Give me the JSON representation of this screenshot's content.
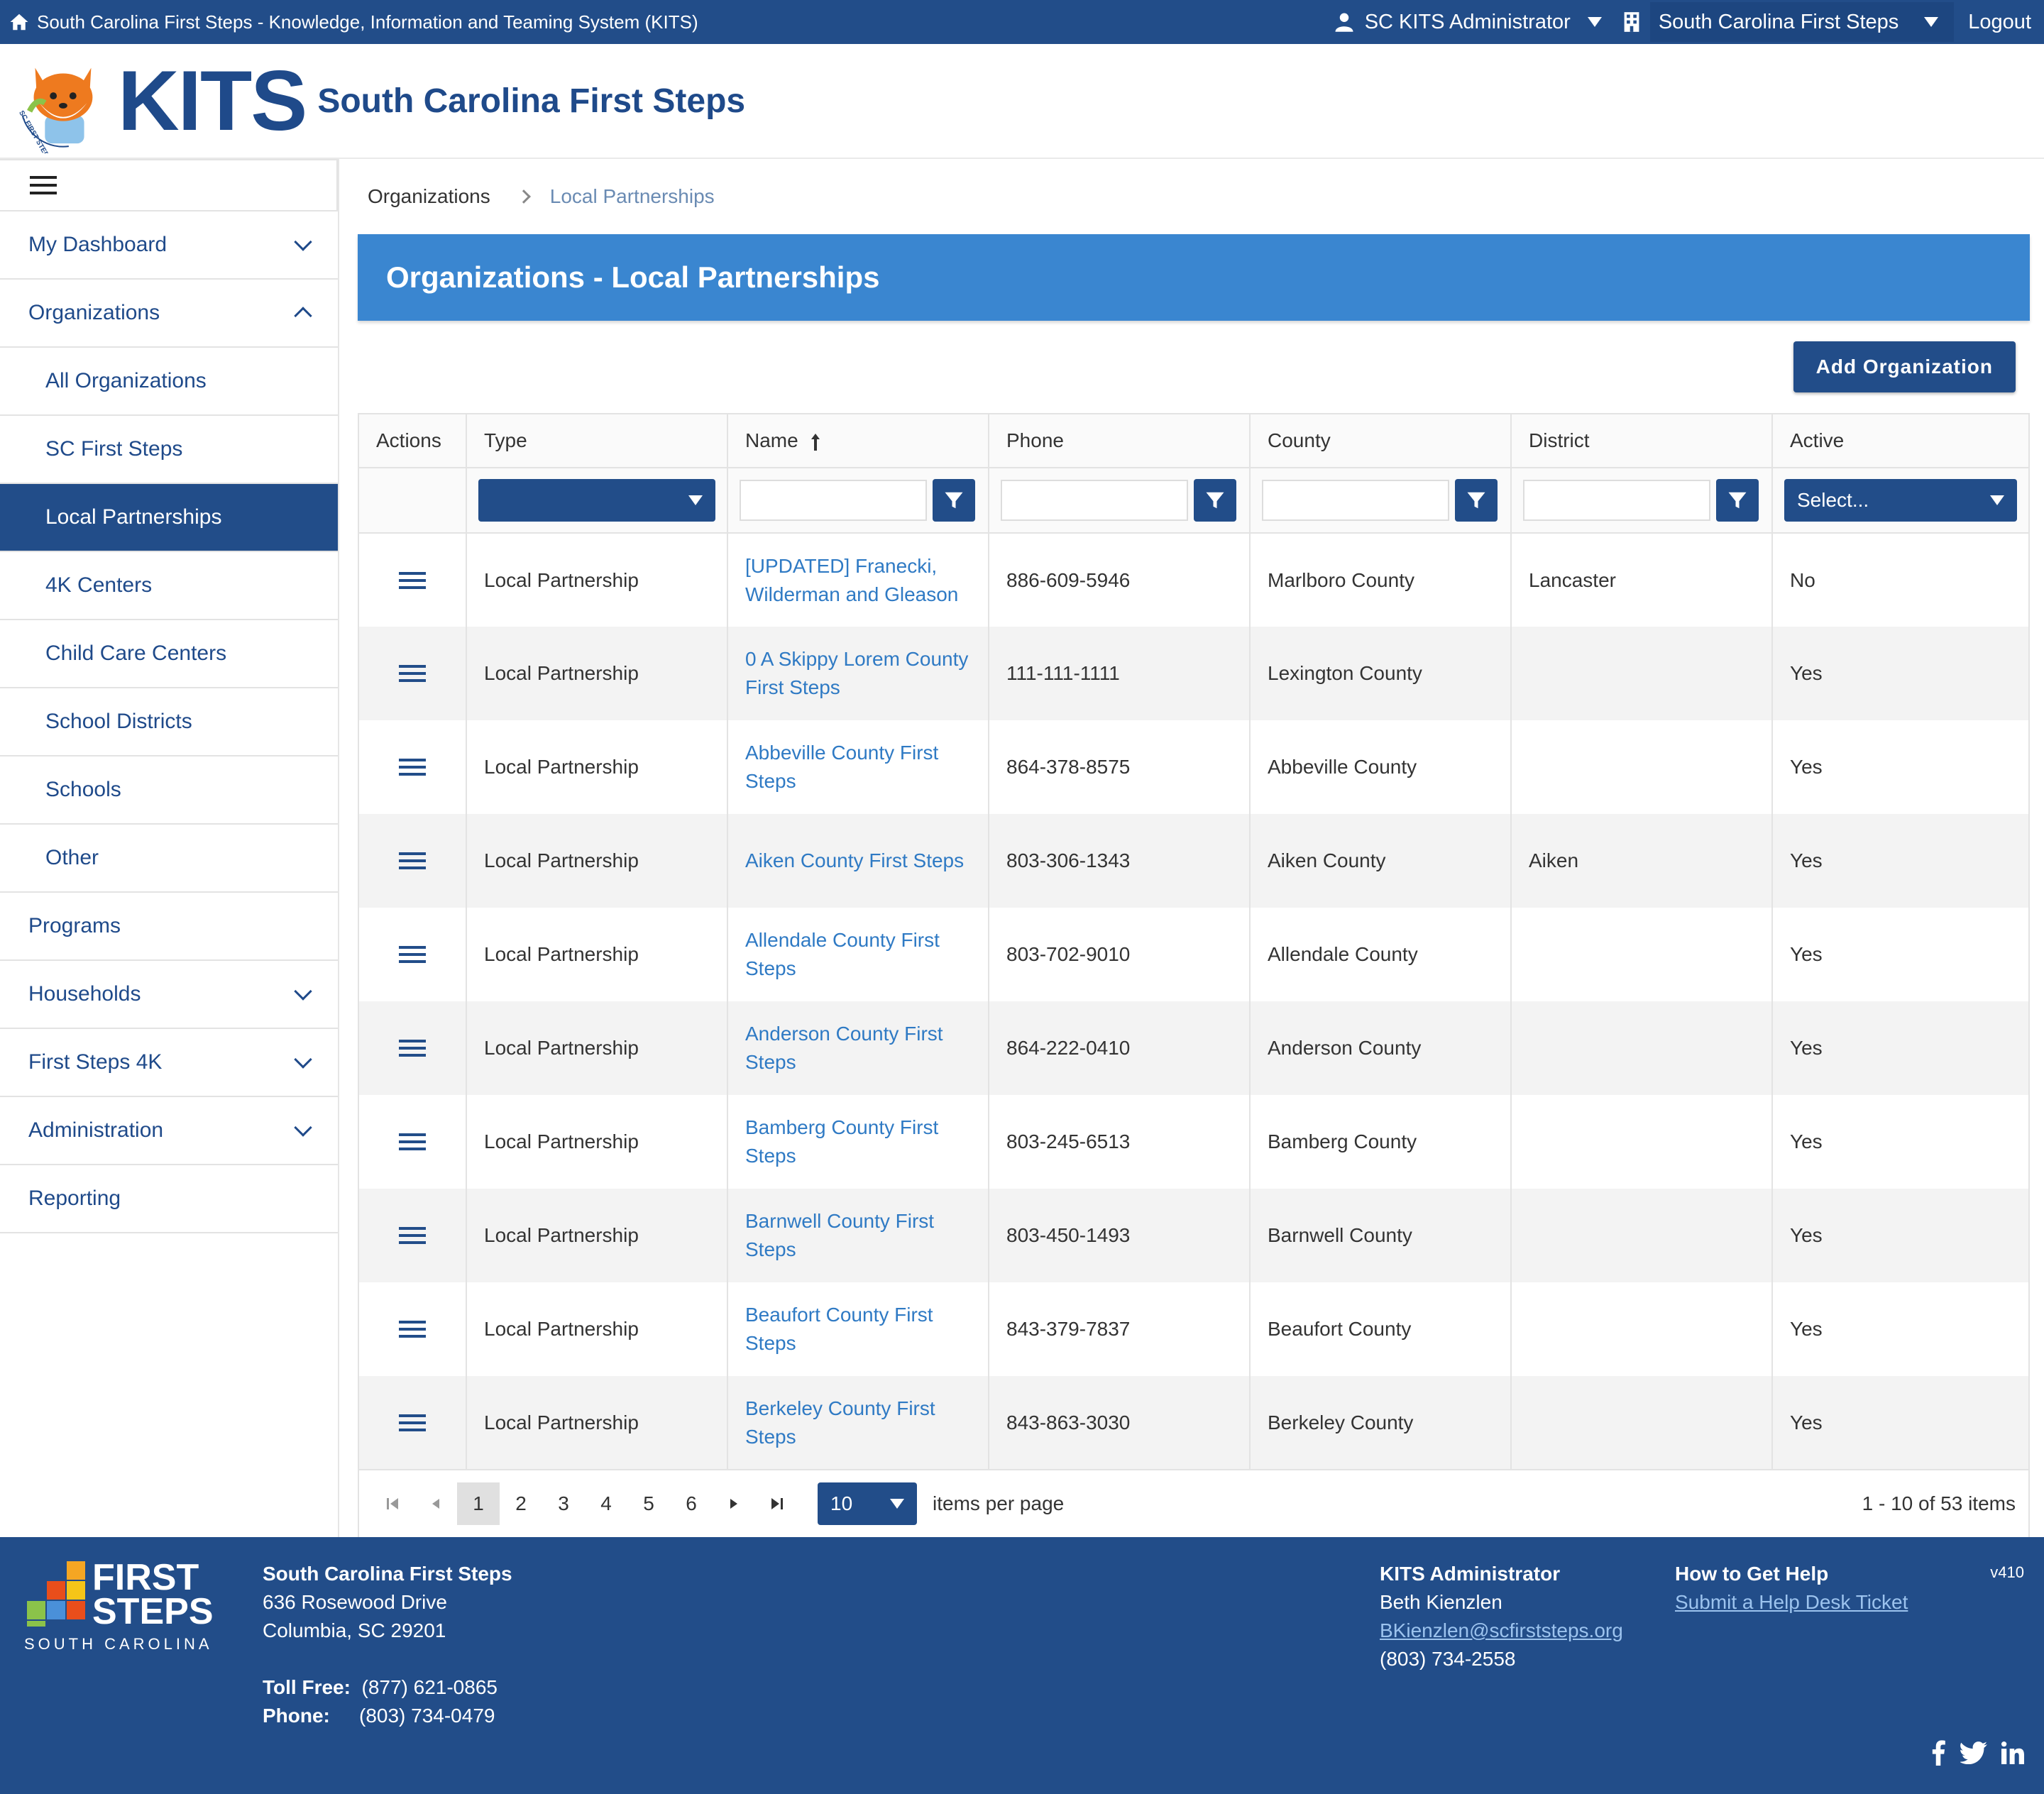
{
  "topbar": {
    "title": "South Carolina First Steps - Knowledge, Information and Teaming System (KITS)",
    "user": "SC KITS Administrator",
    "org": "South Carolina First Steps",
    "logout": "Logout"
  },
  "header": {
    "logo_text": "SC FIRST STEPS",
    "brand": "KITS",
    "subtitle": "South Carolina First Steps"
  },
  "sidebar": {
    "items": [
      {
        "label": "My Dashboard"
      },
      {
        "label": "Organizations"
      },
      {
        "label": "All Organizations"
      },
      {
        "label": "SC First Steps"
      },
      {
        "label": "Local Partnerships"
      },
      {
        "label": "4K Centers"
      },
      {
        "label": "Child Care Centers"
      },
      {
        "label": "School Districts"
      },
      {
        "label": "Schools"
      },
      {
        "label": "Other"
      },
      {
        "label": "Programs"
      },
      {
        "label": "Households"
      },
      {
        "label": "First Steps 4K"
      },
      {
        "label": "Administration"
      },
      {
        "label": "Reporting"
      }
    ]
  },
  "breadcrumb": {
    "parent": "Organizations",
    "current": "Local Partnerships"
  },
  "page": {
    "title": "Organizations - Local Partnerships",
    "add_button": "Add Organization"
  },
  "table": {
    "headers": [
      "Actions",
      "Type",
      "Name",
      "Phone",
      "County",
      "District",
      "Active"
    ],
    "active_filter": "Select...",
    "rows": [
      {
        "type": "Local Partnership",
        "name": "[UPDATED] Franecki, Wilderman and Gleason",
        "phone": "886-609-5946",
        "county": "Marlboro County",
        "district": "Lancaster",
        "active": "No"
      },
      {
        "type": "Local Partnership",
        "name": "0 A Skippy Lorem County First Steps",
        "phone": "111-111-1111",
        "county": "Lexington County",
        "district": "",
        "active": "Yes"
      },
      {
        "type": "Local Partnership",
        "name": "Abbeville County First Steps",
        "phone": "864-378-8575",
        "county": "Abbeville County",
        "district": "",
        "active": "Yes"
      },
      {
        "type": "Local Partnership",
        "name": "Aiken County First Steps",
        "phone": "803-306-1343",
        "county": "Aiken County",
        "district": "Aiken",
        "active": "Yes"
      },
      {
        "type": "Local Partnership",
        "name": "Allendale County First Steps",
        "phone": "803-702-9010",
        "county": "Allendale County",
        "district": "",
        "active": "Yes"
      },
      {
        "type": "Local Partnership",
        "name": "Anderson County First Steps",
        "phone": "864-222-0410",
        "county": "Anderson County",
        "district": "",
        "active": "Yes"
      },
      {
        "type": "Local Partnership",
        "name": "Bamberg County First Steps",
        "phone": "803-245-6513",
        "county": "Bamberg County",
        "district": "",
        "active": "Yes"
      },
      {
        "type": "Local Partnership",
        "name": "Barnwell County First Steps",
        "phone": "803-450-1493",
        "county": "Barnwell County",
        "district": "",
        "active": "Yes"
      },
      {
        "type": "Local Partnership",
        "name": "Beaufort County First Steps",
        "phone": "843-379-7837",
        "county": "Beaufort County",
        "district": "",
        "active": "Yes"
      },
      {
        "type": "Local Partnership",
        "name": "Berkeley County First Steps",
        "phone": "843-863-3030",
        "county": "Berkeley County",
        "district": "",
        "active": "Yes"
      }
    ]
  },
  "pager": {
    "pages": [
      "1",
      "2",
      "3",
      "4",
      "5",
      "6"
    ],
    "current": "1",
    "page_size": "10",
    "items_per_page_label": "items per page",
    "summary": "1 - 10 of 53 items"
  },
  "footer": {
    "logo_line1": "FIRST",
    "logo_line2": "STEPS",
    "logo_line3": "SOUTH CAROLINA",
    "org_name": "South Carolina First Steps",
    "address1": "636 Rosewood Drive",
    "address2": "Columbia, SC 29201",
    "tollfree_label": "Toll Free:",
    "tollfree": "(877) 621-0865",
    "phone_label": "Phone:",
    "phone": "(803) 734-0479",
    "admin_title": "KITS Administrator",
    "admin_name": "Beth Kienzlen",
    "admin_email": "BKienzlen@scfirststeps.org",
    "admin_phone": "(803) 734-2558",
    "help_title": "How to Get Help",
    "help_link": "Submit a Help Desk Ticket",
    "version": "v410"
  },
  "colors": {
    "navy": "#224d89",
    "banner": "#3a86d0",
    "link": "#2f7ac4"
  }
}
